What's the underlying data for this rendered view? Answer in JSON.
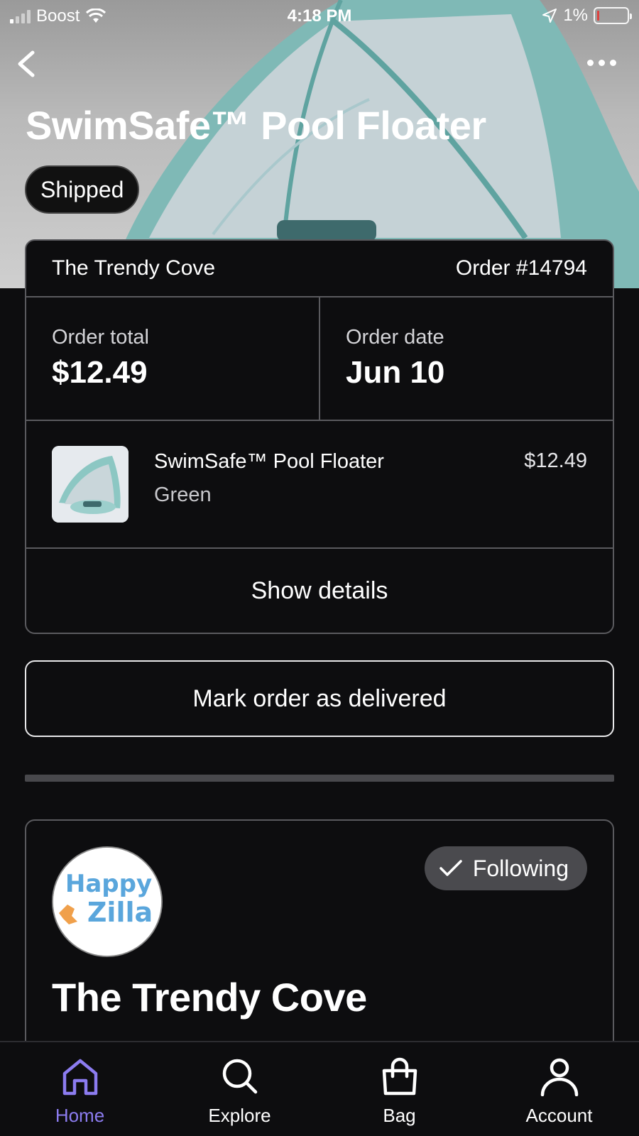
{
  "status_bar": {
    "carrier": "Boost",
    "time": "4:18 PM",
    "battery": "1%"
  },
  "header": {
    "title": "SwimSafe™ Pool Floater",
    "status": "Shipped"
  },
  "order": {
    "store": "The Trendy Cove",
    "number": "Order #14794",
    "total_label": "Order total",
    "total_value": "$12.49",
    "date_label": "Order date",
    "date_value": "Jun 10",
    "item": {
      "name": "SwimSafe™ Pool Floater",
      "variant": "Green",
      "price": "$12.49"
    },
    "details_label": "Show details"
  },
  "actions": {
    "mark_delivered": "Mark order as delivered"
  },
  "store": {
    "logo_text_top": "Happy",
    "logo_text_bottom": "Zilla",
    "follow_label": "Following",
    "name": "The Trendy Cove"
  },
  "tabs": [
    {
      "label": "Home",
      "icon": "home-icon",
      "active": true
    },
    {
      "label": "Explore",
      "icon": "search-icon",
      "active": false
    },
    {
      "label": "Bag",
      "icon": "bag-icon",
      "active": false
    },
    {
      "label": "Account",
      "icon": "account-icon",
      "active": false
    }
  ],
  "colors": {
    "accent": "#8c7cf0",
    "background": "#0d0d0f",
    "battery_low": "#e53935"
  }
}
